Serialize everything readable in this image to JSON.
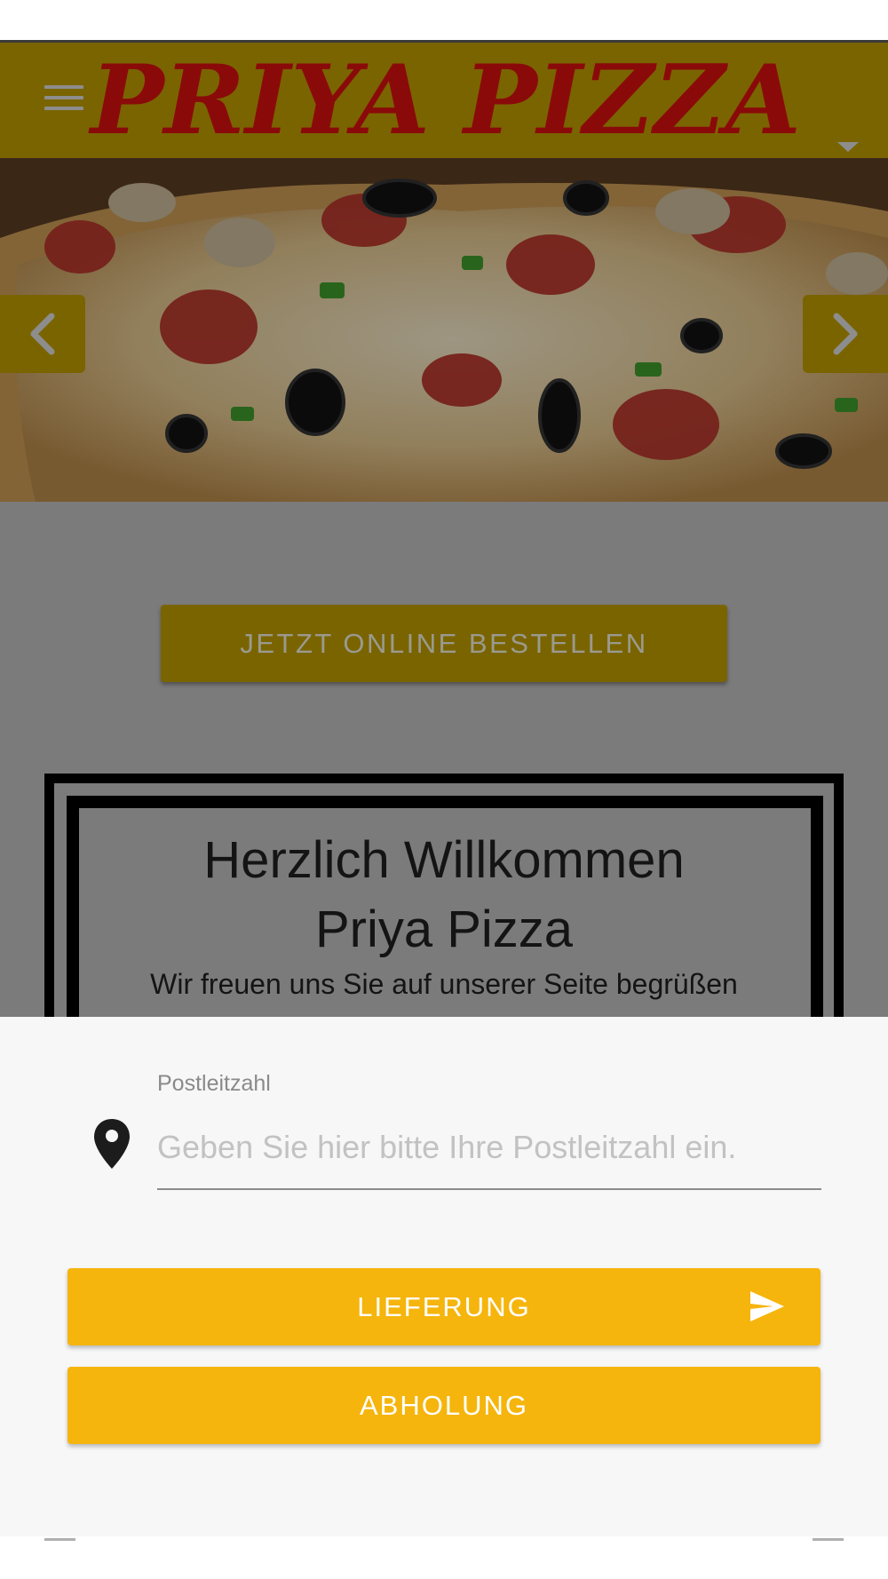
{
  "header": {
    "logo_text": "PRIYA PIZZA",
    "menu_icon": "hamburger-menu-icon",
    "dropdown_icon": "caret-down-icon"
  },
  "hero": {
    "image": "pizza-photo",
    "prev_icon": "chevron-left-icon",
    "next_icon": "chevron-right-icon"
  },
  "main": {
    "order_button_label": "JETZT ONLINE BESTELLEN",
    "welcome_title_line1": "Herzlich Willkommen",
    "welcome_title_line2": "Priya Pizza",
    "welcome_subtitle": "Wir freuen uns Sie auf unserer Seite begrüßen"
  },
  "sheet": {
    "postcode_label": "Postleitzahl",
    "postcode_placeholder": "Geben Sie hier bitte Ihre Postleitzahl ein.",
    "postcode_value": "",
    "location_icon": "map-pin-icon",
    "delivery_label": "LIEFERUNG",
    "delivery_icon": "send-icon",
    "pickup_label": "ABHOLUNG"
  },
  "colors": {
    "header_dimmed": "#7a6400",
    "logo_red": "#8a0a0a",
    "accent_yellow": "#f5b50c",
    "overlay_gray": "#7b7b7b",
    "sheet_bg": "#f7f7f7"
  }
}
